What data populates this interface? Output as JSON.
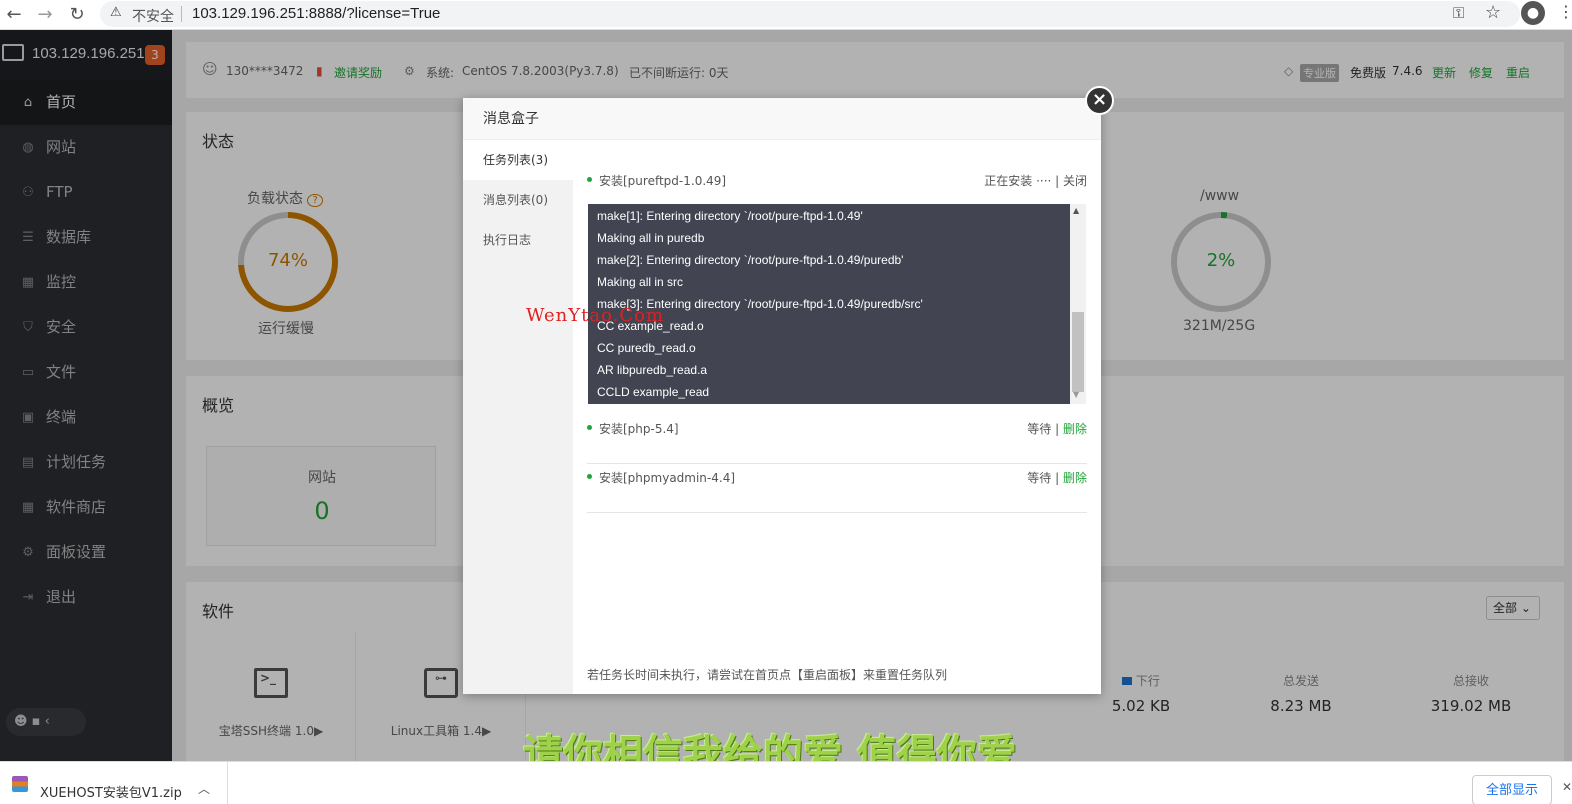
{
  "browser": {
    "back": "←",
    "forward": "→",
    "reload": "↻",
    "security_label": "不安全",
    "url": "103.129.196.251:8888/?license=True"
  },
  "sidebar": {
    "server_ip": "103.129.196.251",
    "notification_count": "3",
    "items": [
      {
        "label": "首页",
        "icon": "⌂"
      },
      {
        "label": "网站",
        "icon": "◍"
      },
      {
        "label": "FTP",
        "icon": "⚇"
      },
      {
        "label": "数据库",
        "icon": "☰"
      },
      {
        "label": "监控",
        "icon": "▦"
      },
      {
        "label": "安全",
        "icon": "⛉"
      },
      {
        "label": "文件",
        "icon": "▭"
      },
      {
        "label": "终端",
        "icon": "▣"
      },
      {
        "label": "计划任务",
        "icon": "▤"
      },
      {
        "label": "软件商店",
        "icon": "▦"
      },
      {
        "label": "面板设置",
        "icon": "⚙"
      },
      {
        "label": "退出",
        "icon": "⇥"
      }
    ],
    "bottom": "☻ ▪ ‹"
  },
  "topinfo": {
    "user": "130****3472",
    "invite": "邀请奖励",
    "system_label": "系统:",
    "system": "CentOS 7.8.2003(Py3.7.8)",
    "uptime": "已不间断运行: 0天",
    "pro_badge": "专业版",
    "edition": "免费版",
    "version": "7.4.6",
    "update": "更新",
    "repair": "修复",
    "restart": "重启"
  },
  "status": {
    "title": "状态",
    "load_label": "负载状态",
    "load_value": "74%",
    "load_status": "运行缓慢",
    "disk_label": "/www",
    "disk_value": "2%",
    "disk_usage": "321M/25G"
  },
  "overview": {
    "title": "概览",
    "site_label": "网站",
    "site_count": "0"
  },
  "software": {
    "title": "软件",
    "filter": "全部",
    "cards": [
      "宝塔SSH终端 1.0▶",
      "Linux工具箱 1.4▶"
    ],
    "net": [
      {
        "label": "下行",
        "value": "5.02 KB"
      },
      {
        "label": "总发送",
        "value": "8.23 MB"
      },
      {
        "label": "总接收",
        "value": "319.02 MB"
      }
    ]
  },
  "modal": {
    "title": "消息盒子",
    "close": "×",
    "tabs": [
      "任务列表(3)",
      "消息列表(0)",
      "执行日志"
    ],
    "tasks": [
      {
        "name": "安装[pureftpd-1.0.49]",
        "status": "正在安装 ···· | 关闭"
      },
      {
        "name": "安装[php-5.4]",
        "status": "等待 | ",
        "action": "删除"
      },
      {
        "name": "安装[phpmyadmin-4.4]",
        "status": "等待 | ",
        "action": "删除"
      }
    ],
    "log_lines": [
      "make[1]: Entering directory `/root/pure-ftpd-1.0.49'",
      "Making all in puredb",
      "make[2]: Entering directory `/root/pure-ftpd-1.0.49/puredb'",
      "Making all in src",
      "make[3]: Entering directory `/root/pure-ftpd-1.0.49/puredb/src'",
      "CC example_read.o",
      "CC puredb_read.o",
      "AR libpuredb_read.a",
      "CCLD example_read"
    ],
    "footer": "若任务长时间未执行，请尝试在首页点【重启面板】来重置任务队列"
  },
  "watermark": "WenYtao.Com",
  "video_subtitle": "请你相信我给的爱 值得你爱",
  "downloads": {
    "file": "XUEHOST安装包V1.zip",
    "show_all": "全部显示"
  },
  "colors": {
    "accent": "#20a53a",
    "warning": "#cc7a00",
    "log_bg": "#434452"
  }
}
